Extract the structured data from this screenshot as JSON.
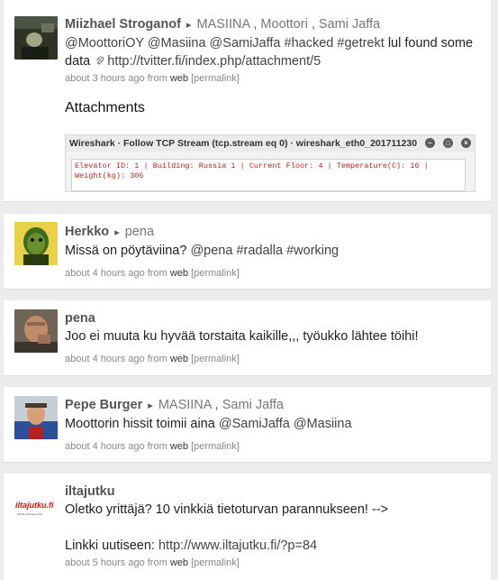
{
  "notices": [
    {
      "author": "Miizhael Stroganof",
      "arrow": "▸",
      "groups": [
        "MASIINA",
        "Moottori",
        "Sami Jaffa"
      ],
      "text_line1_parts": [
        "@MoottoriOY",
        "@Masiina",
        "@SamiJaffa",
        "#hacked",
        "#getrekt",
        "lul found some"
      ],
      "text_line2_prefix": "data",
      "link": "http://tvitter.fi/index.php/attachment/5",
      "time": "about 3 hours ago",
      "from": "from",
      "source": "web",
      "permalink": "[permalink]",
      "attachments_title": "Attachments",
      "attachment": {
        "title": "Wireshark · Follow TCP Stream (tcp.stream eq 0) · wireshark_eth0_201711230",
        "body": "Elevator ID: 1 | Building: Russia 1 | Current Floor: 4 | Temperature(C): 16 |\nWeight(kg): 306"
      }
    },
    {
      "author": "Herkko",
      "arrow": "▸",
      "groups": [
        "pena"
      ],
      "text_parts": [
        "Missä on pöytäviina?",
        "@pena",
        "#radalla",
        "#working"
      ],
      "time": "about 4 hours ago",
      "from": "from",
      "source": "web",
      "permalink": "[permalink]"
    },
    {
      "author": "pena",
      "text": "Joo ei muuta ku hyvää torstaita kaikille,,, työukko lähtee töihi!",
      "time": "about 4 hours ago",
      "from": "from",
      "source": "web",
      "permalink": "[permalink]"
    },
    {
      "author": "Pepe Burger",
      "arrow": "▸",
      "groups": [
        "MASIINA",
        "Sami Jaffa"
      ],
      "text_parts": [
        "Moottorin hissit toimii aina",
        "@SamiJaffa",
        "@Masiina"
      ],
      "time": "about 4 hours ago",
      "from": "from",
      "source": "web",
      "permalink": "[permalink]"
    },
    {
      "author": "iltajutku",
      "avatar_logo": "iltajutku.fi",
      "avatar_tagline": "Päivän parhaat vinkit",
      "text": "Oletko yrittäjä? 10 vinkkiä tietoturvan parannukseen! -->",
      "text2_prefix": "Linkki uutiseen:",
      "link": "http://www.iltajutku.fi/?p=84",
      "time": "about 5 hours ago",
      "from": "from",
      "source": "web",
      "permalink": "[permalink]"
    }
  ],
  "colors": {
    "background": "#ececec",
    "card": "#ffffff",
    "accent": "#444444",
    "error_text": "#c02020"
  }
}
